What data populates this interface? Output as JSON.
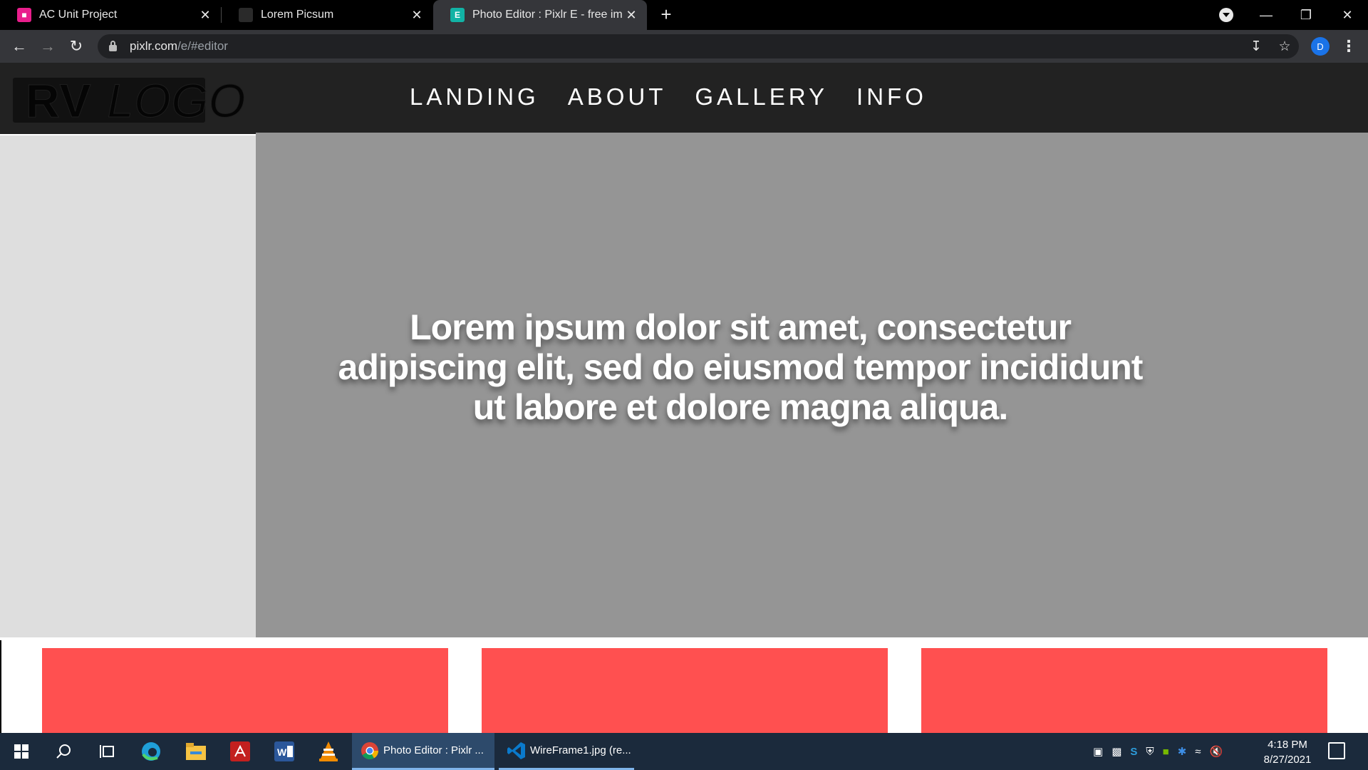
{
  "browser": {
    "tabs": [
      {
        "title": "AC Unit Project",
        "favicon_color": "#e91e8c"
      },
      {
        "title": "Lorem Picsum",
        "favicon_color": "#333333"
      },
      {
        "title": "Photo Editor : Pixlr E - free image",
        "favicon_color": "#12b3a5",
        "active": true
      }
    ],
    "address": {
      "host": "pixlr.com",
      "path": "/e/#editor"
    },
    "profile_initial": "D"
  },
  "site": {
    "logo": {
      "letters": "RV",
      "word": "LOGO"
    },
    "nav": [
      "LANDING",
      "ABOUT",
      "GALLERY",
      "INFO"
    ],
    "hero_text": "Lorem ipsum dolor sit amet, consectetur adipiscing elit, sed do eiusmod tempor incididunt ut labore et dolore magna aliqua.",
    "colors": {
      "header": "#222222",
      "hero": "#959595",
      "side": "#dedede",
      "card": "#ff5050"
    }
  },
  "taskbar": {
    "apps": [
      {
        "label": "Photo Editor : Pixlr ...",
        "icon": "chrome-icon",
        "active": true
      },
      {
        "label": "WireFrame1.jpg (re...",
        "icon": "vscode-icon",
        "active": false
      }
    ],
    "time": "4:18 PM",
    "date": "8/27/2021"
  }
}
